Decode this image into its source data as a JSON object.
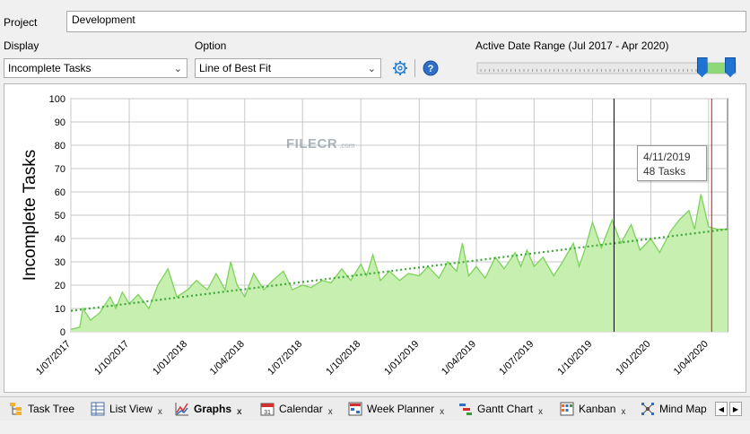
{
  "project": {
    "label": "Project",
    "value": "Development"
  },
  "display": {
    "label": "Display",
    "value": "Incomplete Tasks"
  },
  "option": {
    "label": "Option",
    "value": "Line of Best Fit"
  },
  "date_range": {
    "label": "Active Date Range (Jul 2017 - Apr 2020)",
    "selected_start_fraction": 0.87,
    "selected_end_fraction": 1.0
  },
  "icons": {
    "settings": "gear-icon",
    "help": "question-icon"
  },
  "tooltip": {
    "date": "4/11/2019",
    "value": "48 Tasks"
  },
  "watermark": {
    "brand": "FILECR",
    "domain": ".com"
  },
  "tabs": [
    {
      "label": "Task Tree",
      "icon": "task-tree-icon",
      "closable": false
    },
    {
      "label": "List View",
      "icon": "list-view-icon",
      "closable": true
    },
    {
      "label": "Graphs",
      "icon": "graphs-icon",
      "closable": true,
      "active": true
    },
    {
      "label": "Calendar",
      "icon": "calendar-icon",
      "closable": true
    },
    {
      "label": "Week Planner",
      "icon": "week-planner-icon",
      "closable": true
    },
    {
      "label": "Gantt Chart",
      "icon": "gantt-icon",
      "closable": true
    },
    {
      "label": "Kanban",
      "icon": "kanban-icon",
      "closable": true
    },
    {
      "label": "Mind Map",
      "icon": "mind-map-icon",
      "closable": false
    }
  ],
  "colors": {
    "area_fill": "#c6efb0",
    "line": "#7dd35a",
    "trend": "#3fa83a",
    "cursor": "#000000",
    "today": "#e03030"
  },
  "chart_data": {
    "type": "area",
    "ylabel": "Incomplete Tasks",
    "ylim": [
      0,
      100
    ],
    "y_ticks": [
      0,
      10,
      20,
      30,
      40,
      50,
      60,
      70,
      80,
      90,
      100
    ],
    "x_range": [
      "2017-07-01",
      "2020-05-01"
    ],
    "x_ticks": [
      "1/07/2017",
      "1/10/2017",
      "1/01/2018",
      "1/04/2018",
      "1/07/2018",
      "1/10/2018",
      "1/01/2019",
      "1/04/2019",
      "1/07/2019",
      "1/10/2019",
      "1/01/2020",
      "1/04/2020"
    ],
    "grid": true,
    "series": [
      {
        "values": [
          [
            "2017-07-01",
            1
          ],
          [
            "2017-07-15",
            2
          ],
          [
            "2017-07-20",
            10
          ],
          [
            "2017-08-01",
            5
          ],
          [
            "2017-08-15",
            8
          ],
          [
            "2017-09-01",
            15
          ],
          [
            "2017-09-10",
            10
          ],
          [
            "2017-09-20",
            17
          ],
          [
            "2017-10-01",
            12
          ],
          [
            "2017-10-15",
            16
          ],
          [
            "2017-11-01",
            10
          ],
          [
            "2017-11-15",
            20
          ],
          [
            "2017-12-01",
            27
          ],
          [
            "2017-12-15",
            15
          ],
          [
            "2018-01-01",
            18
          ],
          [
            "2018-01-15",
            22
          ],
          [
            "2018-02-01",
            18
          ],
          [
            "2018-02-15",
            25
          ],
          [
            "2018-03-01",
            18
          ],
          [
            "2018-03-10",
            30
          ],
          [
            "2018-03-20",
            20
          ],
          [
            "2018-04-01",
            15
          ],
          [
            "2018-04-15",
            25
          ],
          [
            "2018-05-01",
            18
          ],
          [
            "2018-05-15",
            22
          ],
          [
            "2018-06-01",
            26
          ],
          [
            "2018-06-15",
            18
          ],
          [
            "2018-07-01",
            20
          ],
          [
            "2018-07-15",
            19
          ],
          [
            "2018-08-01",
            22
          ],
          [
            "2018-08-15",
            21
          ],
          [
            "2018-09-01",
            27
          ],
          [
            "2018-09-15",
            22
          ],
          [
            "2018-10-01",
            29
          ],
          [
            "2018-10-10",
            24
          ],
          [
            "2018-10-20",
            33
          ],
          [
            "2018-11-01",
            22
          ],
          [
            "2018-11-15",
            26
          ],
          [
            "2018-12-01",
            22
          ],
          [
            "2018-12-15",
            25
          ],
          [
            "2019-01-01",
            24
          ],
          [
            "2019-01-15",
            28
          ],
          [
            "2019-02-01",
            23
          ],
          [
            "2019-02-15",
            30
          ],
          [
            "2019-03-01",
            26
          ],
          [
            "2019-03-10",
            38
          ],
          [
            "2019-03-20",
            24
          ],
          [
            "2019-04-01",
            28
          ],
          [
            "2019-04-15",
            23
          ],
          [
            "2019-05-01",
            32
          ],
          [
            "2019-05-15",
            27
          ],
          [
            "2019-06-01",
            34
          ],
          [
            "2019-06-10",
            28
          ],
          [
            "2019-06-20",
            35
          ],
          [
            "2019-07-01",
            28
          ],
          [
            "2019-07-15",
            32
          ],
          [
            "2019-08-01",
            24
          ],
          [
            "2019-08-15",
            30
          ],
          [
            "2019-09-01",
            38
          ],
          [
            "2019-09-10",
            28
          ],
          [
            "2019-09-20",
            36
          ],
          [
            "2019-10-01",
            47
          ],
          [
            "2019-10-15",
            36
          ],
          [
            "2019-11-01",
            48
          ],
          [
            "2019-11-15",
            38
          ],
          [
            "2019-12-01",
            46
          ],
          [
            "2019-12-15",
            35
          ],
          [
            "2020-01-01",
            40
          ],
          [
            "2020-01-15",
            34
          ],
          [
            "2020-02-01",
            43
          ],
          [
            "2020-02-15",
            48
          ],
          [
            "2020-03-01",
            52
          ],
          [
            "2020-03-10",
            44
          ],
          [
            "2020-03-20",
            59
          ],
          [
            "2020-04-01",
            45
          ],
          [
            "2020-04-15",
            44
          ],
          [
            "2020-05-01",
            44
          ]
        ]
      }
    ],
    "trend_line": [
      [
        "2017-07-01",
        9
      ],
      [
        "2020-05-01",
        44
      ]
    ],
    "markers": {
      "cursor_date": "2019-11-04",
      "today_date": "2020-04-06"
    }
  }
}
